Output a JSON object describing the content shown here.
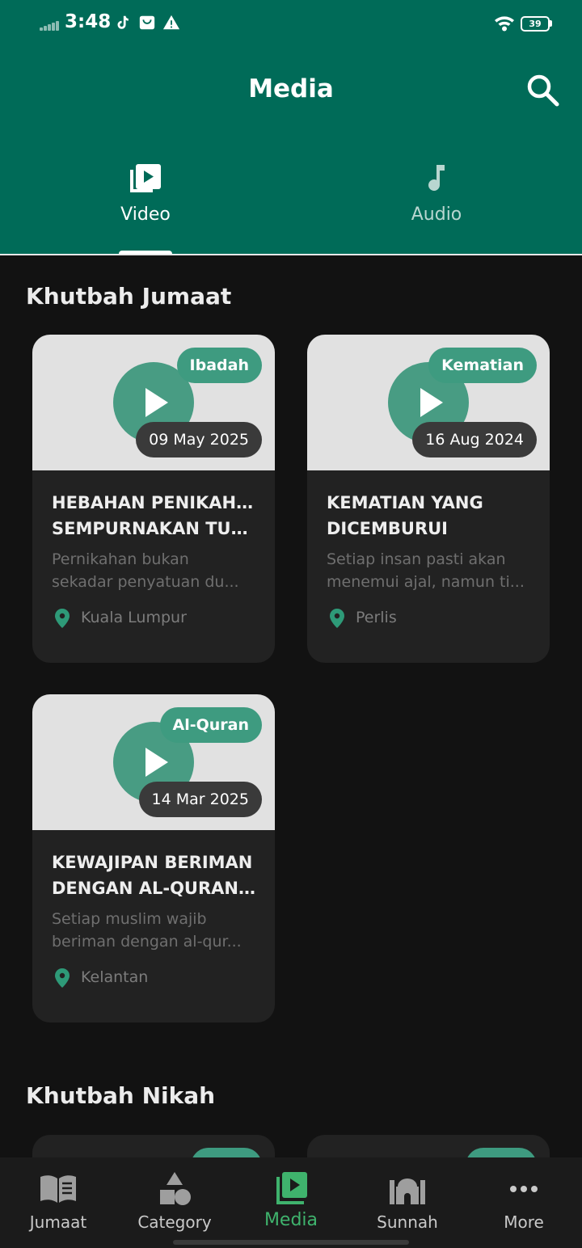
{
  "status": {
    "time": "3:48",
    "battery": "39",
    "icons": [
      "signal-icon",
      "tiktok-icon",
      "shop-icon",
      "alert-icon",
      "wifi-icon",
      "battery-icon"
    ]
  },
  "header": {
    "title": "Media",
    "search_icon": "search-icon",
    "background": "#006B58"
  },
  "tabs": [
    {
      "label": "Video",
      "icon": "video-library-icon",
      "active": true
    },
    {
      "label": "Audio",
      "icon": "music-note-icon",
      "active": false
    }
  ],
  "sections": [
    {
      "title": "Khutbah Jumaat",
      "cards": [
        {
          "category": "Ibadah",
          "date": "09 May 2025",
          "title_lines": [
            "HEBAHAN PENIKAHAN",
            "SEMPURNAKAN TUNT..."
          ],
          "desc_lines": [
            "Pernikahan bukan",
            "sekadar penyatuan du..."
          ],
          "location": "Kuala Lumpur"
        },
        {
          "category": "Kematian",
          "date": "16 Aug 2024",
          "title_lines": [
            "KEMATIAN YANG",
            "DICEMBURUI"
          ],
          "desc_lines": [
            "Setiap insan pasti akan",
            "menemui ajal, namun ti..."
          ],
          "location": "Perlis"
        },
        {
          "category": "Al-Quran",
          "date": "14 Mar 2025",
          "title_lines": [
            "KEWAJIPAN BERIMAN",
            "DENGAN AL-QURAN ..."
          ],
          "desc_lines": [
            "Setiap muslim wajib",
            "beriman dengan al-qur..."
          ],
          "location": "Kelantan"
        }
      ]
    },
    {
      "title": "Khutbah Nikah"
    }
  ],
  "bottom_nav": [
    {
      "label": "Jumaat",
      "icon": "book-icon",
      "active": false
    },
    {
      "label": "Category",
      "icon": "shapes-icon",
      "active": false
    },
    {
      "label": "Media",
      "icon": "video-library-icon",
      "active": true
    },
    {
      "label": "Sunnah",
      "icon": "mosque-icon",
      "active": false
    },
    {
      "label": "More",
      "icon": "more-dots-icon",
      "active": false
    }
  ],
  "colors": {
    "primary": "#006B58",
    "accent_green": "#3FB36D",
    "badge_green": "#3E9B80",
    "background": "#121212",
    "card": "#222222"
  }
}
